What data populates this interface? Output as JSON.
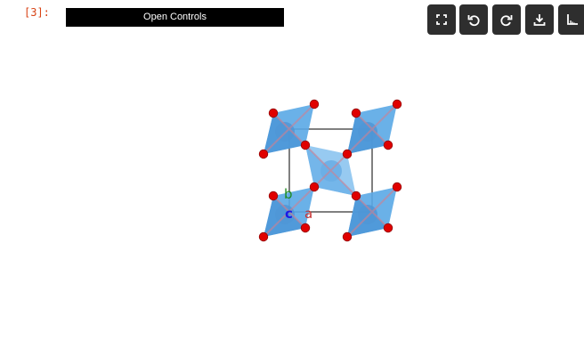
{
  "cell": {
    "prompt": "[3]:",
    "open_controls_label": "Open Controls"
  },
  "toolbar": {
    "buttons": [
      {
        "name": "fullscreen-icon",
        "tooltip": ""
      },
      {
        "name": "undo-icon",
        "tooltip": ""
      },
      {
        "name": "redo-icon",
        "tooltip": ""
      },
      {
        "name": "download-icon",
        "tooltip": ""
      },
      {
        "name": "axes-icon",
        "tooltip": ""
      }
    ]
  },
  "structure": {
    "axes": {
      "a": "a",
      "b": "b",
      "c": "c"
    },
    "colors": {
      "octahedron": "#5aa9e6",
      "octahedron_dark": "#3d88c8",
      "atom": "#e00000",
      "cell_edge": "#000000",
      "axis_a": "#c83232",
      "axis_b": "#1e8c1e",
      "axis_c": "#1a1ae6"
    }
  }
}
